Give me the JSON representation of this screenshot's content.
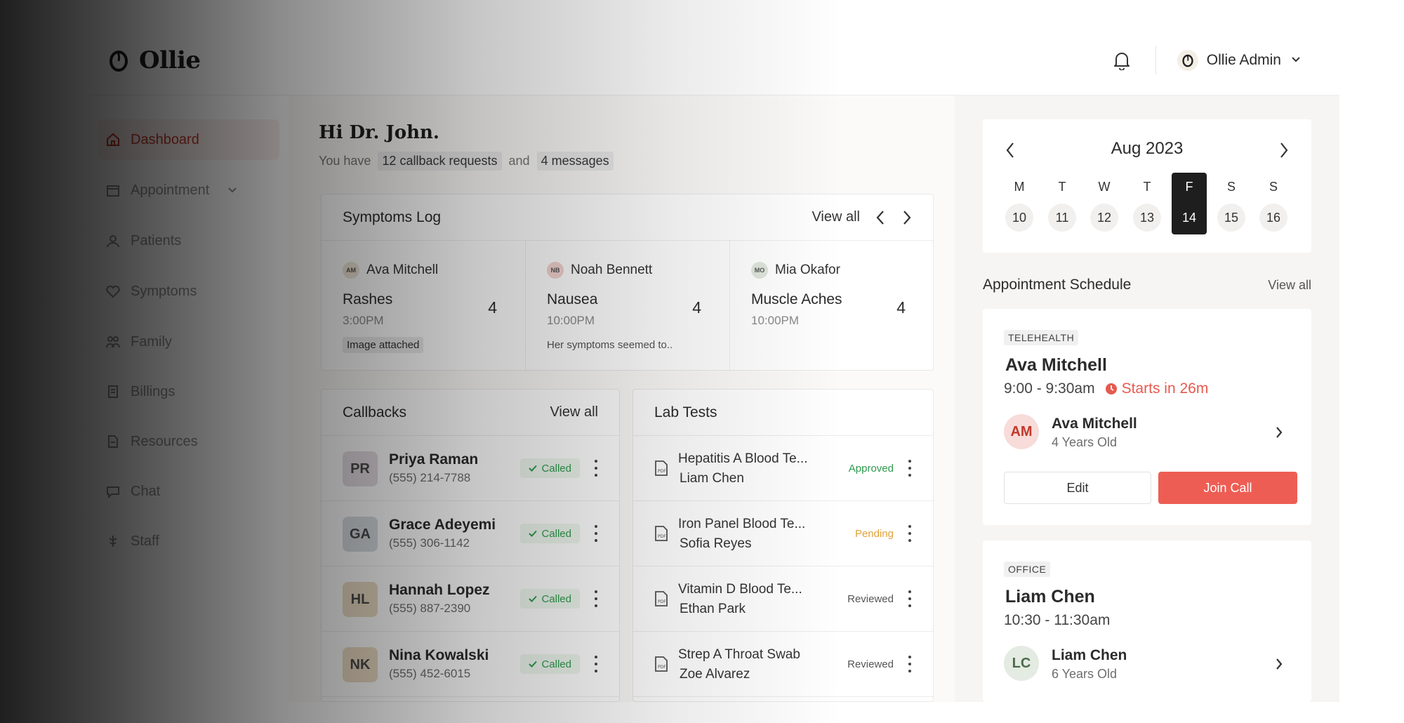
{
  "brand": {
    "name": "Ollie"
  },
  "header": {
    "admin_name": "Ollie Admin"
  },
  "sidebar": {
    "items": [
      {
        "label": "Dashboard"
      },
      {
        "label": "Appointment"
      },
      {
        "label": "Patients"
      },
      {
        "label": "Symptoms"
      },
      {
        "label": "Family"
      },
      {
        "label": "Billings"
      },
      {
        "label": "Resources"
      },
      {
        "label": "Chat"
      },
      {
        "label": "Staff"
      }
    ]
  },
  "greeting": {
    "title": "Hi Dr. John.",
    "prefix": "You have",
    "callbacks": "12 callback requests",
    "conj": "and",
    "messages": "4 messages"
  },
  "symptoms": {
    "title": "Symptoms Log",
    "view_all": "View all",
    "items": [
      {
        "initials": "AM",
        "person": "Ava Mitchell",
        "symptom": "Rashes",
        "time": "3:00PM",
        "count": "4",
        "note": "Image attached"
      },
      {
        "initials": "NB",
        "person": "Noah Bennett",
        "symptom": "Nausea",
        "time": "10:00PM",
        "count": "4",
        "note": "Her symptoms seemed to.."
      },
      {
        "initials": "MO",
        "person": "Mia Okafor",
        "symptom": "Muscle Aches",
        "time": "10:00PM",
        "count": "4",
        "note": ""
      }
    ]
  },
  "callbacks": {
    "title": "Callbacks",
    "view_all": "View all",
    "items": [
      {
        "initials": "PR",
        "name": "Priya Raman",
        "phone": "(555) 214-7788",
        "status": "Called",
        "color": "#e4dde2"
      },
      {
        "initials": "GA",
        "name": "Grace Adeyemi",
        "phone": "(555) 306-1142",
        "status": "Called",
        "color": "#d8dde2"
      },
      {
        "initials": "HL",
        "name": "Hannah Lopez",
        "phone": "(555) 887-2390",
        "status": "Called",
        "color": "#eadcc4"
      },
      {
        "initials": "NK",
        "name": "Nina Kowalski",
        "phone": "(555) 452-6015",
        "status": "Called",
        "color": "#ecdcc4"
      }
    ]
  },
  "lab_tests": {
    "title": "Lab Tests",
    "items": [
      {
        "test": "Hepatitis A Blood Te...",
        "person": "Liam Chen",
        "status": "Approved",
        "status_color": "#2e9b4d"
      },
      {
        "test": "Iron Panel Blood Te...",
        "person": "Sofia Reyes",
        "status": "Pending",
        "status_color": "#e0a23a"
      },
      {
        "test": "Vitamin D Blood Te...",
        "person": "Ethan Park",
        "status": "Reviewed",
        "status_color": "#555555"
      },
      {
        "test": "Strep A Throat Swab",
        "person": "Zoe Alvarez",
        "status": "Reviewed",
        "status_color": "#555555"
      }
    ]
  },
  "calendar": {
    "month": "Aug 2023",
    "days": [
      {
        "label": "M",
        "num": "10"
      },
      {
        "label": "T",
        "num": "11"
      },
      {
        "label": "W",
        "num": "12"
      },
      {
        "label": "T",
        "num": "13"
      },
      {
        "label": "F",
        "num": "14",
        "selected": true
      },
      {
        "label": "S",
        "num": "15"
      },
      {
        "label": "S",
        "num": "16"
      }
    ]
  },
  "schedule": {
    "title": "Appointment Schedule",
    "view_all": "View all",
    "appointments": [
      {
        "type": "TELEHEALTH",
        "name": "Ava Mitchell",
        "time": "9:00 - 9:30am",
        "starts": "Starts in 26m",
        "initials": "AM",
        "patient": "Ava Mitchell",
        "age": "4 Years Old",
        "edit": "Edit",
        "join": "Join Call"
      },
      {
        "type": "OFFICE",
        "name": "Liam Chen",
        "time": "10:30 - 11:30am",
        "initials": "LC",
        "patient": "Liam Chen",
        "age": "6 Years Old"
      }
    ]
  },
  "colors": {
    "accent": "#ee5d53",
    "called_green": "#2e9b4d",
    "nav_active": "#c0392b"
  }
}
